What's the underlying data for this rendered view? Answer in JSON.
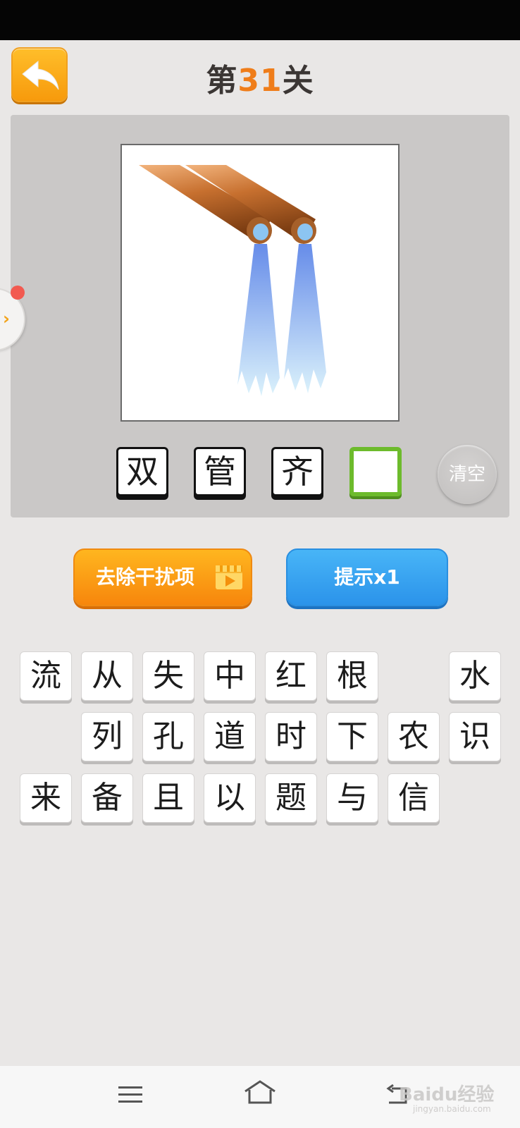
{
  "header": {
    "level_prefix": "第",
    "level_number": "31",
    "level_suffix": "关",
    "back_icon": "back-arrow-icon"
  },
  "puzzle": {
    "image_icon": "two-pipes-water-icon",
    "answer": [
      "双",
      "管",
      "齐",
      ""
    ],
    "clear_label": "清空"
  },
  "actions": {
    "remove_label": "去除干扰项",
    "hint_label": "提示x1"
  },
  "candidates": {
    "row1": [
      "流",
      "从",
      "失",
      "中",
      "红",
      "根",
      "",
      "水"
    ],
    "row2": [
      "",
      "列",
      "孔",
      "道",
      "时",
      "下",
      "农",
      "识"
    ],
    "row3": [
      "来",
      "备",
      "且",
      "以",
      "题",
      "与",
      "信",
      ""
    ]
  },
  "watermark": {
    "text": "Baidu经验",
    "sub": "jingyan.baidu.com"
  },
  "colors": {
    "accent_orange": "#ef7d1a",
    "hint_blue": "#2b93ea",
    "active_slot_green": "#6dbb2c"
  }
}
